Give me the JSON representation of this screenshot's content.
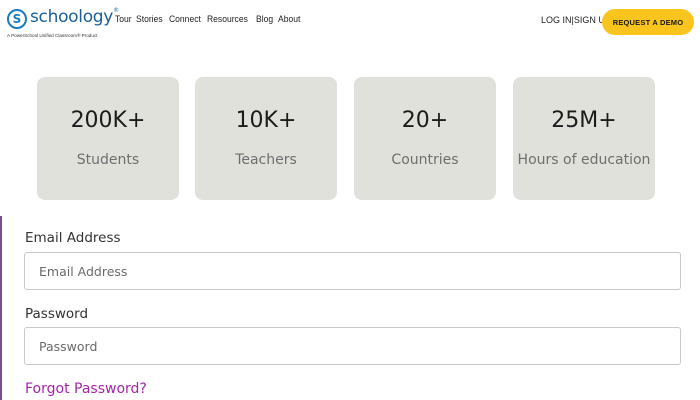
{
  "brand": {
    "logo_letter": "S",
    "name": "schoology",
    "trademark": "®",
    "tagline": "A PowerSchool Unified Classroom® Product"
  },
  "nav": {
    "items": [
      {
        "label": "Tour"
      },
      {
        "label": "Stories"
      },
      {
        "label": "Connect"
      },
      {
        "label": "Resources"
      },
      {
        "label": "Blog"
      },
      {
        "label": "About"
      }
    ],
    "login_label": "LOG IN",
    "separator": "|",
    "signup_label": "SIGN UP",
    "cta_label": "REQUEST A DEMO",
    "cta_color": "#f9c41d"
  },
  "stats": [
    {
      "value": "200K+",
      "label": "Students"
    },
    {
      "value": "10K+",
      "label": "Teachers"
    },
    {
      "value": "20+",
      "label": "Countries"
    },
    {
      "value": "25M+",
      "label": "Hours of education"
    }
  ],
  "form": {
    "email_label": "Email Address",
    "email_placeholder": "Email Address",
    "password_label": "Password",
    "password_placeholder": "Password",
    "forgot_label": "Forgot Password?",
    "link_color": "#a425a8"
  }
}
